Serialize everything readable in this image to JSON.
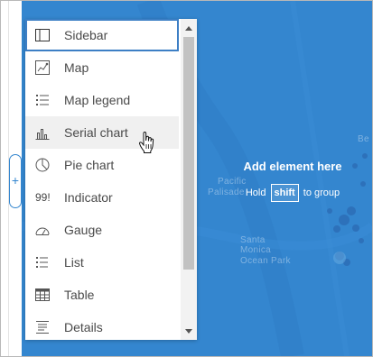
{
  "canvas": {
    "drop_title": "Add element here",
    "drop_hint_before": "Hold",
    "drop_hint_key": "shift",
    "drop_hint_after": "to group",
    "map_labels": [
      "Pacific",
      "Palisade",
      "Santa",
      "Monica",
      "Ocean Park",
      "Be"
    ],
    "colors": {
      "map_blue": "#3486cf",
      "accent": "#3d7fc5"
    }
  },
  "add_handle": {
    "symbol": "+"
  },
  "menu": {
    "items": [
      {
        "label": "Sidebar",
        "icon": "sidebar-icon",
        "state": "selected"
      },
      {
        "label": "Map",
        "icon": "map-icon"
      },
      {
        "label": "Map legend",
        "icon": "map-legend-icon"
      },
      {
        "label": "Serial chart",
        "icon": "serial-chart-icon",
        "state": "hover"
      },
      {
        "label": "Pie chart",
        "icon": "pie-chart-icon"
      },
      {
        "label": "Indicator",
        "icon": "indicator-icon",
        "icon_text": "99!"
      },
      {
        "label": "Gauge",
        "icon": "gauge-icon"
      },
      {
        "label": "List",
        "icon": "list-icon"
      },
      {
        "label": "Table",
        "icon": "table-icon"
      },
      {
        "label": "Details",
        "icon": "details-icon"
      }
    ]
  }
}
